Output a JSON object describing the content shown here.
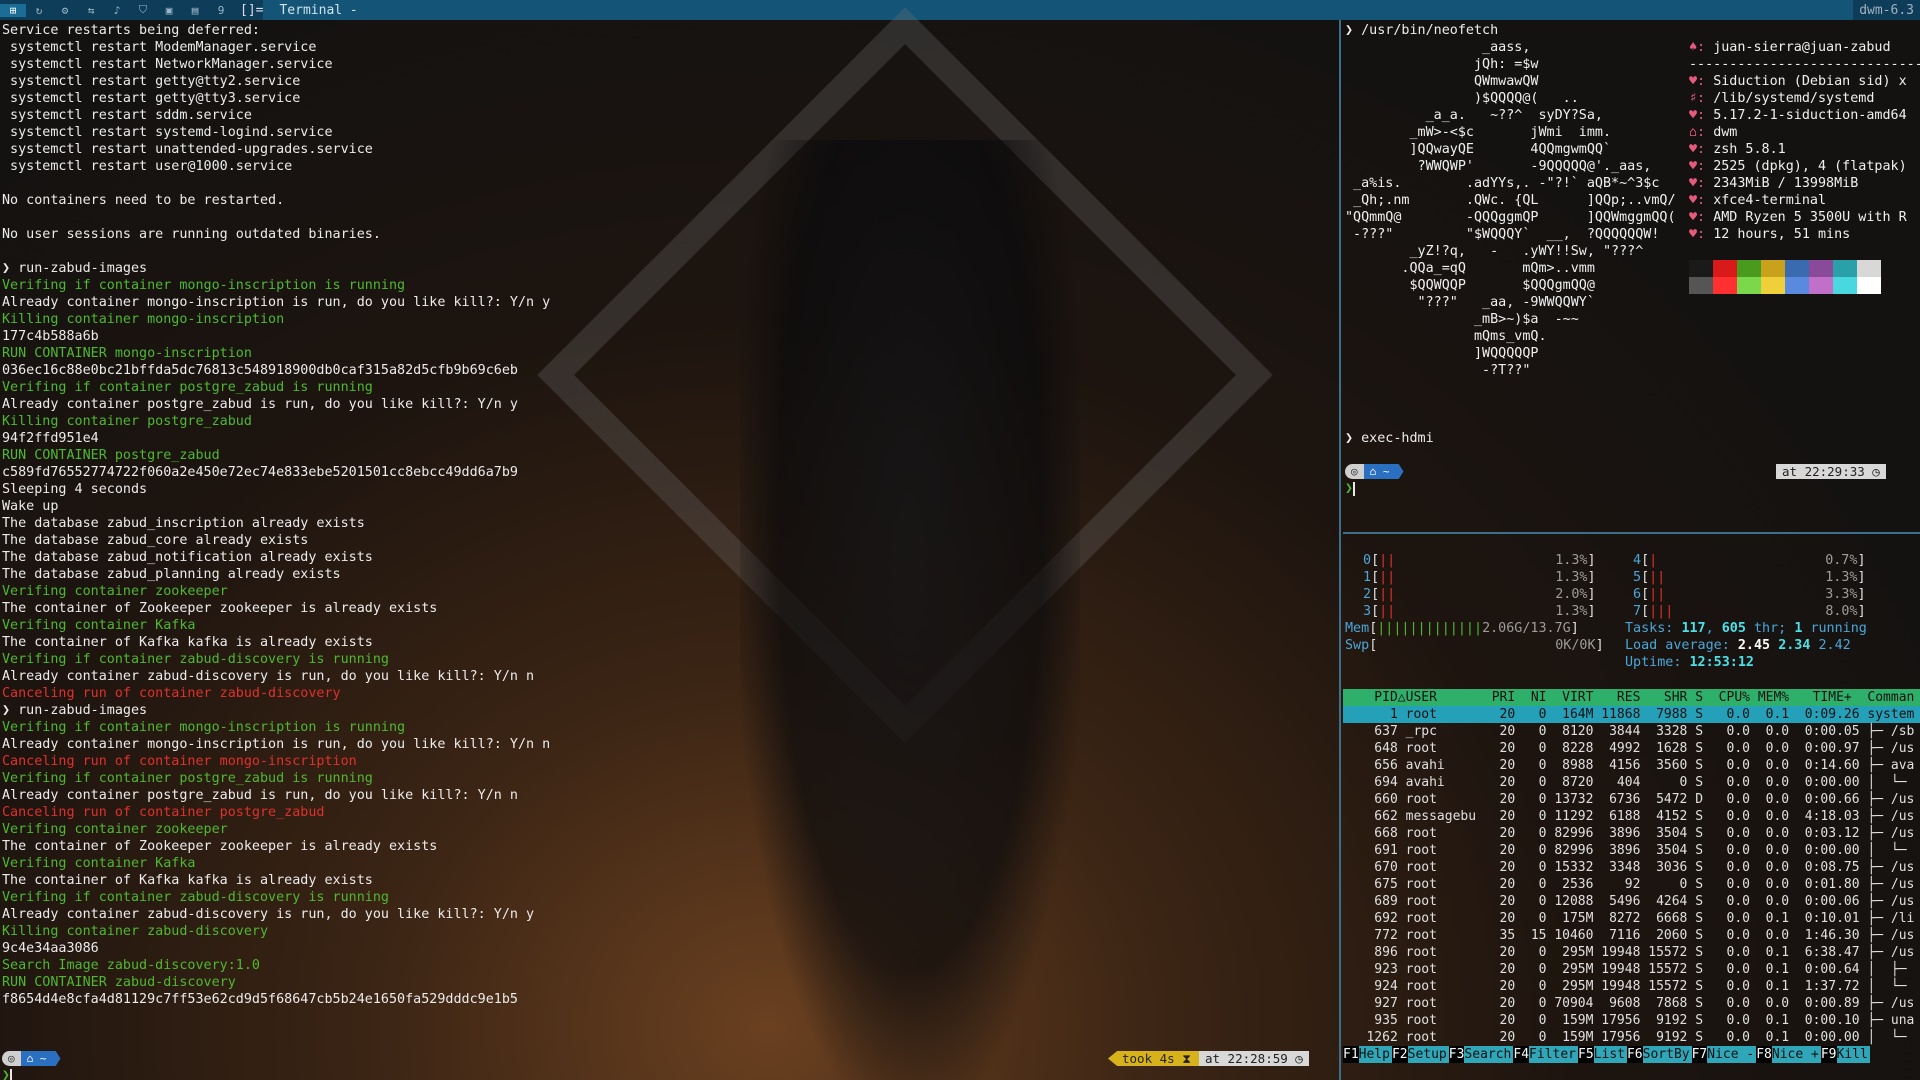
{
  "topbar": {
    "workspaces": [
      "⊞",
      "↻",
      "⚙",
      "⇆",
      "♪",
      "⛉",
      "▣",
      "▤",
      "9"
    ],
    "layout": "[]=",
    "title": "Terminal -",
    "wm": "dwm-6.3"
  },
  "left_terminal": {
    "lines": [
      {
        "t": "Service restarts being deferred:",
        "c": "white"
      },
      {
        "t": " systemctl restart ModemManager.service",
        "c": "white"
      },
      {
        "t": " systemctl restart NetworkManager.service",
        "c": "white"
      },
      {
        "t": " systemctl restart getty@tty2.service",
        "c": "white"
      },
      {
        "t": " systemctl restart getty@tty3.service",
        "c": "white"
      },
      {
        "t": " systemctl restart sddm.service",
        "c": "white"
      },
      {
        "t": " systemctl restart systemd-logind.service",
        "c": "white"
      },
      {
        "t": " systemctl restart unattended-upgrades.service",
        "c": "white"
      },
      {
        "t": " systemctl restart user@1000.service",
        "c": "white"
      },
      {
        "t": "",
        "c": "white"
      },
      {
        "t": "No containers need to be restarted.",
        "c": "white"
      },
      {
        "t": "",
        "c": "white"
      },
      {
        "t": "No user sessions are running outdated binaries.",
        "c": "white"
      },
      {
        "t": "",
        "c": "white"
      },
      {
        "t": "❯ run-zabud-images",
        "c": "white"
      },
      {
        "t": "Verifing if container mongo-inscription is running",
        "c": "green"
      },
      {
        "t": "Already container mongo-inscription is run, do you like kill?: Y/n y",
        "c": "white"
      },
      {
        "t": "Killing container mongo-inscription",
        "c": "green"
      },
      {
        "t": "177c4b588a6b",
        "c": "white"
      },
      {
        "t": "RUN CONTAINER mongo-inscription",
        "c": "green"
      },
      {
        "t": "036ec16c88e0bc21bffda5dc76813c548918900db0caf315a82d5cfb9b69c6eb",
        "c": "white"
      },
      {
        "t": "Verifing if container postgre_zabud is running",
        "c": "green"
      },
      {
        "t": "Already container postgre_zabud is run, do you like kill?: Y/n y",
        "c": "white"
      },
      {
        "t": "Killing container postgre_zabud",
        "c": "green"
      },
      {
        "t": "94f2ffd951e4",
        "c": "white"
      },
      {
        "t": "RUN CONTAINER postgre_zabud",
        "c": "green"
      },
      {
        "t": "c589fd76552774722f060a2e450e72ec74e833ebe5201501cc8ebcc49dd6a7b9",
        "c": "white"
      },
      {
        "t": "Sleeping 4 seconds",
        "c": "white"
      },
      {
        "t": "Wake up",
        "c": "white"
      },
      {
        "t": "The database zabud_inscription already exists",
        "c": "white"
      },
      {
        "t": "The database zabud_core already exists",
        "c": "white"
      },
      {
        "t": "The database zabud_notification already exists",
        "c": "white"
      },
      {
        "t": "The database zabud_planning already exists",
        "c": "white"
      },
      {
        "t": "Verifing container zookeeper",
        "c": "green"
      },
      {
        "t": "The container of Zookeeper zookeeper is already exists",
        "c": "white"
      },
      {
        "t": "Verifing container Kafka",
        "c": "green"
      },
      {
        "t": "The container of Kafka kafka is already exists",
        "c": "white"
      },
      {
        "t": "Verifing if container zabud-discovery is running",
        "c": "green"
      },
      {
        "t": "Already container zabud-discovery is run, do you like kill?: Y/n n",
        "c": "white"
      },
      {
        "t": "Canceling run of container zabud-discovery",
        "c": "red"
      },
      {
        "t": "❯ run-zabud-images",
        "c": "white"
      },
      {
        "t": "Verifing if container mongo-inscription is running",
        "c": "green"
      },
      {
        "t": "Already container mongo-inscription is run, do you like kill?: Y/n n",
        "c": "white"
      },
      {
        "t": "Canceling run of container mongo-inscription",
        "c": "red"
      },
      {
        "t": "Verifing if container postgre_zabud is running",
        "c": "green"
      },
      {
        "t": "Already container postgre_zabud is run, do you like kill?: Y/n n",
        "c": "white"
      },
      {
        "t": "Canceling run of container postgre_zabud",
        "c": "red"
      },
      {
        "t": "Verifing container zookeeper",
        "c": "green"
      },
      {
        "t": "The container of Zookeeper zookeeper is already exists",
        "c": "white"
      },
      {
        "t": "Verifing container Kafka",
        "c": "green"
      },
      {
        "t": "The container of Kafka kafka is already exists",
        "c": "white"
      },
      {
        "t": "Verifing if container zabud-discovery is running",
        "c": "green"
      },
      {
        "t": "Already container zabud-discovery is run, do you like kill?: Y/n y",
        "c": "white"
      },
      {
        "t": "Killing container zabud-discovery",
        "c": "green"
      },
      {
        "t": "9c4e34aa3086",
        "c": "white"
      },
      {
        "t": "Search Image zabud-discovery:1.0",
        "c": "green"
      },
      {
        "t": "RUN CONTAINER zabud-discovery",
        "c": "green"
      },
      {
        "t": "f8654d4e8cfa4d81129c7ff53e62cd9d5f68647cb5b24e1650fa529dddc9e1b5",
        "c": "white"
      }
    ],
    "prompt_home": "◎",
    "prompt_dir": "⌂ ~",
    "took": "took 4s ⧗",
    "at_time": "at 22:28:59 ◷",
    "cursor_prompt": "❯"
  },
  "neofetch": {
    "command": "❯ /usr/bin/neofetch",
    "art": [
      "                 _aass,",
      "                jQh: =$w",
      "                QWmwawQW",
      "                )$QQQQ@(   ..",
      "          _a_a.   ~??^  syDY?Sa,",
      "        _mW>-<$c       jWmi  imm.",
      "        ]QQwayQE       4QQmgwmQQ`",
      "         ?WWQWP'       -9QQQQQ@'._aas,",
      " _a%is.        .adYYs,. -\"?!` aQB*~^3$c",
      " _Qh;.nm       .QWc. {QL      ]QQp;..vmQ/",
      "\"QQmmQ@        -QQQggmQP      ]QQWmggmQQ(",
      " -???\"         \"$WQQQY`  __,  ?QQQQQQW!",
      "        _yZ!?q,   -   .yWY!!Sw, \"???^",
      "       .QQa_=qQ       mQm>..vmm",
      "        $QQWQQP       $QQQgmQQ@",
      "         \"???\"   _aa, -9WWQQWY`",
      "                _mB>~)$a  -~~",
      "                mQms_vmQ.",
      "                ]WQQQQQP",
      "                 -?T??\""
    ],
    "user_host": "juan-sierra@juan-zabud",
    "separator": "--------------------------------",
    "info": [
      {
        "k": "♥",
        "v": "Siduction (Debian sid) x"
      },
      {
        "k": "♯",
        "v": "/lib/systemd/systemd"
      },
      {
        "k": "♥",
        "v": "5.17.2-1-siduction-amd64"
      },
      {
        "k": "⌂",
        "v": "dwm"
      },
      {
        "k": "♥",
        "v": "zsh 5.8.1"
      },
      {
        "k": "♥",
        "v": "2525 (dpkg), 4 (flatpak)"
      },
      {
        "k": "♥",
        "v": "2343MiB / 13998MiB"
      },
      {
        "k": "♥",
        "v": "xfce4-terminal"
      },
      {
        "k": "♥",
        "v": "AMD Ryzen 5 3500U with R"
      },
      {
        "k": "♥",
        "v": "12 hours, 51 mins"
      }
    ],
    "palette_top": [
      "#1a1a1a",
      "#d91a1a",
      "#4a9a1e",
      "#c8a21a",
      "#3a6ab0",
      "#8a4a9a",
      "#2aa0a8",
      "#d8d8d8"
    ],
    "palette_bottom": [
      "#555555",
      "#ff3030",
      "#7ad84a",
      "#f0d03a",
      "#5a8ae0",
      "#c070c8",
      "#4ad8e0",
      "#ffffff"
    ],
    "second_command": "❯ exec-hdmi",
    "prompt_home": "◎",
    "prompt_dir": "⌂ ~",
    "at_time": "at 22:29:33 ◷",
    "cursor_prompt": "❯"
  },
  "htop": {
    "cpus_left": [
      {
        "n": "0",
        "bar": "||",
        "pct": "1.3%"
      },
      {
        "n": "1",
        "bar": "||",
        "pct": "1.3%"
      },
      {
        "n": "2",
        "bar": "||",
        "pct": "2.0%"
      },
      {
        "n": "3",
        "bar": "||",
        "pct": "1.3%"
      }
    ],
    "cpus_right": [
      {
        "n": "4",
        "bar": "|",
        "pct": "0.7%"
      },
      {
        "n": "5",
        "bar": "||",
        "pct": "1.3%"
      },
      {
        "n": "6",
        "bar": "||",
        "pct": "3.3%"
      },
      {
        "n": "7",
        "bar": "|||",
        "pct": "8.0%"
      }
    ],
    "mem_label": "Mem",
    "mem_bar": "|||||||||||||",
    "mem_val": "2.06G/13.7G",
    "swp_label": "Swp",
    "swp_val": "0K/0K",
    "tasks_label": "Tasks:",
    "tasks": "117",
    "threads": "605",
    "thr_label": "thr;",
    "running": "1",
    "running_label": "running",
    "load_label": "Load average:",
    "load1": "2.45",
    "load5": "2.34",
    "load15": "2.42",
    "uptime_label": "Uptime:",
    "uptime": "12:53:12",
    "header": "    PID△USER       PRI  NI  VIRT   RES   SHR S  CPU% MEM%   TIME+  Comman",
    "processes": [
      "      1 root        20   0  164M 11868  7988 S   0.0  0.1  0:09.26 system",
      "    637 _rpc        20   0  8120  3844  3328 S   0.0  0.0  0:00.05 ├─ /sb",
      "    648 root        20   0  8228  4992  1628 S   0.0  0.0  0:00.97 ├─ /us",
      "    656 avahi       20   0  8988  4156  3560 S   0.0  0.0  0:14.60 ├─ ava",
      "    694 avahi       20   0  8720   404     0 S   0.0  0.0  0:00.00 │  └─",
      "    660 root        20   0 13732  6736  5472 D   0.0  0.0  0:00.66 ├─ /us",
      "    662 messagebu   20   0 11292  6188  4152 S   0.0  0.0  4:18.03 ├─ /us",
      "    668 root        20   0 82996  3896  3504 S   0.0  0.0  0:03.12 ├─ /us",
      "    691 root        20   0 82996  3896  3504 S   0.0  0.0  0:00.00 │  └─",
      "    670 root        20   0 15332  3348  3036 S   0.0  0.0  0:08.75 ├─ /us",
      "    675 root        20   0  2536    92     0 S   0.0  0.0  0:01.80 ├─ /us",
      "    689 root        20   0 12088  5496  4264 S   0.0  0.0  0:00.06 ├─ /us",
      "    692 root        20   0  175M  8272  6668 S   0.0  0.1  0:10.01 ├─ /li",
      "    772 root        35  15 10460  7116  2060 S   0.0  0.0  1:46.30 ├─ /us",
      "    896 root        20   0  295M 19948 15572 S   0.0  0.1  6:38.47 ├─ /us",
      "    923 root        20   0  295M 19948 15572 S   0.0  0.1  0:00.64 │  ├─",
      "    924 root        20   0  295M 19948 15572 S   0.0  0.1  1:37.72 │  └─",
      "    927 root        20   0 70904  9608  7868 S   0.0  0.0  0:00.89 ├─ /us",
      "    935 root        20   0  159M 17956  9192 S   0.0  0.1  0:00.10 ├─ una",
      "   1262 root        20   0  159M 17956  9192 S   0.0  0.1  0:00.00 │  └─"
    ],
    "fkeys": [
      {
        "k": "F1",
        "l": "Help  "
      },
      {
        "k": "F2",
        "l": "Setup "
      },
      {
        "k": "F3",
        "l": "Search"
      },
      {
        "k": "F4",
        "l": "Filter"
      },
      {
        "k": "F5",
        "l": "List  "
      },
      {
        "k": "F6",
        "l": "SortBy"
      },
      {
        "k": "F7",
        "l": "Nice -"
      },
      {
        "k": "F8",
        "l": "Nice +"
      },
      {
        "k": "F9",
        "l": "Kill  "
      }
    ]
  }
}
